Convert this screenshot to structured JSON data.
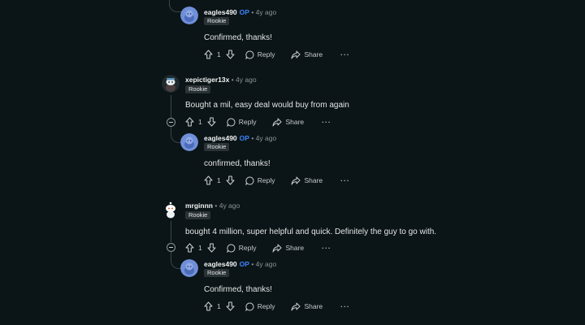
{
  "comments": [
    {
      "username": "eagles490",
      "op_badge": "OP",
      "meta": "• 4y ago",
      "flair": "Rookie",
      "body": "Confirmed, thanks!",
      "votes": "1",
      "reply_label": "Reply",
      "share_label": "Share",
      "more_label": "···",
      "avatar": "snoo-blue"
    },
    {
      "username": "xepictiger13x",
      "meta": "• 4y ago",
      "flair": "Rookie",
      "body": "Bought a mil, easy deal would buy from again",
      "votes": "1",
      "reply_label": "Reply",
      "share_label": "Share",
      "more_label": "···",
      "avatar": "snoo-dark"
    },
    {
      "username": "eagles490",
      "op_badge": "OP",
      "meta": "• 4y ago",
      "flair": "Rookie",
      "body": "confirmed, thanks!",
      "votes": "1",
      "reply_label": "Reply",
      "share_label": "Share",
      "more_label": "···",
      "avatar": "snoo-blue"
    },
    {
      "username": "mrginnn",
      "meta": "• 4y ago",
      "flair": "Rookie",
      "body": "bought 4 million, super helpful and quick. Definitely the guy to go with.",
      "votes": "1",
      "reply_label": "Reply",
      "share_label": "Share",
      "more_label": "···",
      "avatar": "snoo-white"
    },
    {
      "username": "eagles490",
      "op_badge": "OP",
      "meta": "• 4y ago",
      "flair": "Rookie",
      "body": "Confirmed, thanks!",
      "votes": "1",
      "reply_label": "Reply",
      "share_label": "Share",
      "more_label": "···",
      "avatar": "snoo-blue"
    }
  ],
  "colors": {
    "background": "#0b1416",
    "op_badge": "#3a84ff",
    "flair_bg": "#2a3236"
  }
}
